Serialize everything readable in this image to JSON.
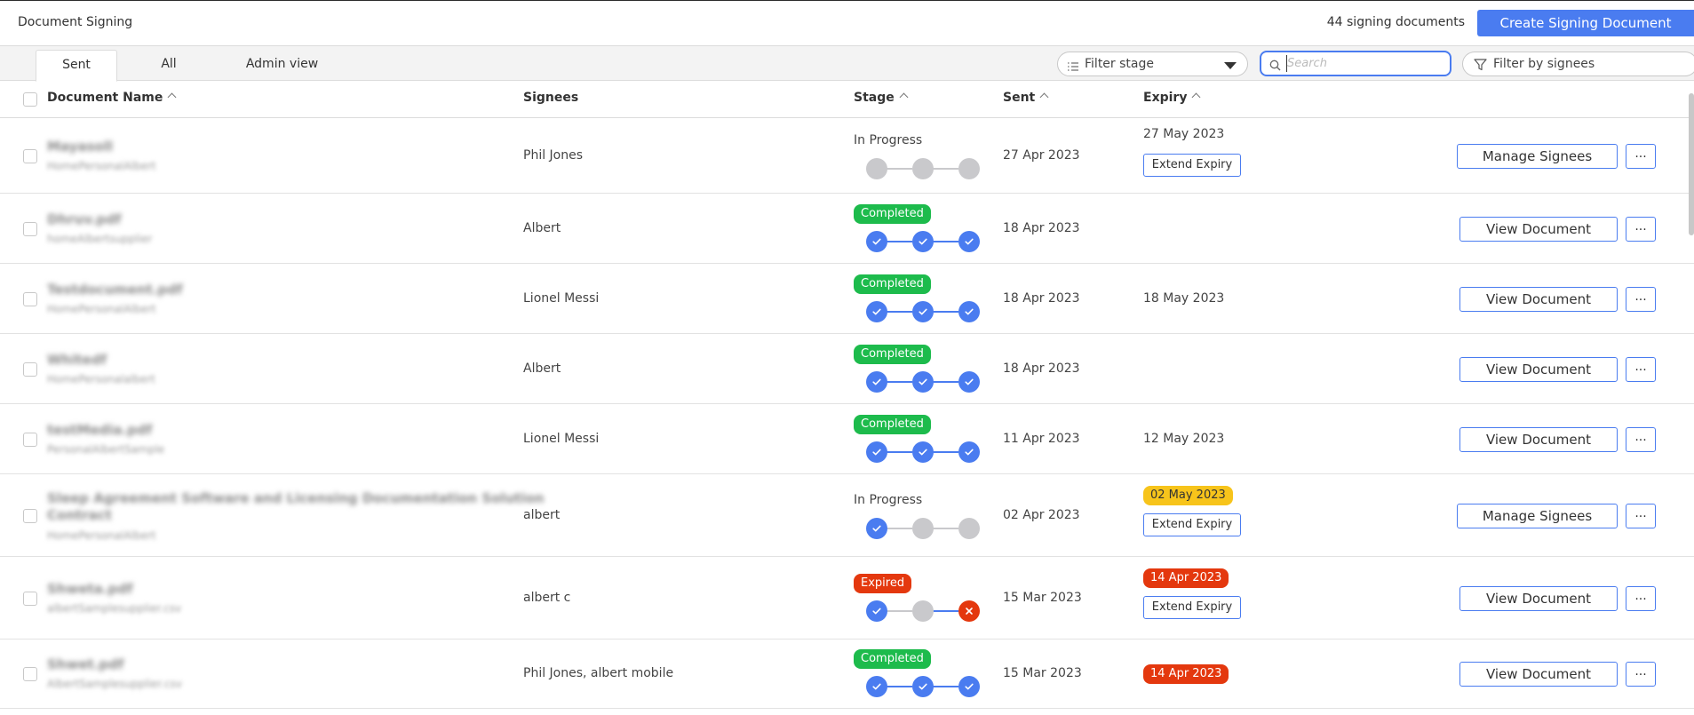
{
  "header": {
    "title": "Document Signing",
    "doc_count": "44 signing documents",
    "create_label": "Create Signing Document"
  },
  "tabs": [
    {
      "label": "Sent",
      "active": true
    },
    {
      "label": "All",
      "active": false
    },
    {
      "label": "Admin view",
      "active": false
    }
  ],
  "filters": {
    "stage_label": "Filter stage",
    "search_placeholder": "Search",
    "signees_label": "Filter by signees"
  },
  "columns": {
    "name": "Document Name",
    "signees": "Signees",
    "stage": "Stage",
    "sent": "Sent",
    "expiry": "Expiry"
  },
  "labels": {
    "extend_expiry": "Extend Expiry",
    "more": "..."
  },
  "colors": {
    "accent": "#4a7cf0",
    "completed": "#1dbb4c",
    "expired": "#e4380e",
    "warning": "#f7c41b"
  },
  "rows": [
    {
      "name": "Mayasoll",
      "sub": "HomePersonalAlbert",
      "signees": "Phil Jones",
      "stage": "In Progress",
      "stage_style": "text",
      "steps": [
        "grey",
        "grey",
        "grey"
      ],
      "sent": "27 Apr 2023",
      "expiry": "27 May 2023",
      "expiry_style": "text",
      "extend": true,
      "action": "Manage Signees"
    },
    {
      "name": "Dhruv.pdf",
      "sub": "homeAlbertsupplier",
      "signees": "Albert",
      "stage": "Completed",
      "stage_style": "green",
      "steps": [
        "blue",
        "blue",
        "blue"
      ],
      "sent": "18 Apr 2023",
      "expiry": "",
      "expiry_style": "text",
      "extend": false,
      "action": "View Document"
    },
    {
      "name": "Testdocument.pdf",
      "sub": "HomePersonalAlbert",
      "signees": "Lionel Messi",
      "stage": "Completed",
      "stage_style": "green",
      "steps": [
        "blue",
        "blue",
        "blue"
      ],
      "sent": "18 Apr 2023",
      "expiry": "18 May 2023",
      "expiry_style": "text",
      "extend": false,
      "action": "View Document"
    },
    {
      "name": "Whitedf",
      "sub": "HomePersonalalbert",
      "signees": "Albert",
      "stage": "Completed",
      "stage_style": "green",
      "steps": [
        "blue",
        "blue",
        "blue"
      ],
      "sent": "18 Apr 2023",
      "expiry": "",
      "expiry_style": "text",
      "extend": false,
      "action": "View Document"
    },
    {
      "name": "testMedia.pdf",
      "sub": "PersonalAlbertSample",
      "signees": "Lionel Messi",
      "stage": "Completed",
      "stage_style": "green",
      "steps": [
        "blue",
        "blue",
        "blue"
      ],
      "sent": "11 Apr 2023",
      "expiry": "12 May 2023",
      "expiry_style": "text",
      "extend": false,
      "action": "View Document"
    },
    {
      "name": "Sleep Agreement Software and Licensing Documentation Solution",
      "name2": "Contract",
      "sub": "HomePersonalAlbert",
      "signees": "albert",
      "stage": "In Progress",
      "stage_style": "text",
      "steps": [
        "blue",
        "grey",
        "grey"
      ],
      "sent": "02 Apr 2023",
      "expiry": "02 May 2023",
      "expiry_style": "yellow",
      "extend": true,
      "action": "Manage Signees"
    },
    {
      "name": "Shweta.pdf",
      "sub": "albertSamplesupplier.csv",
      "signees": "albert c",
      "stage": "Expired",
      "stage_style": "red",
      "steps": [
        "blue",
        "grey",
        "red"
      ],
      "sent": "15 Mar 2023",
      "expiry": "14 Apr 2023",
      "expiry_style": "red",
      "extend": true,
      "action": "View Document"
    },
    {
      "name": "Shwet.pdf",
      "sub": "AlbertSamplesupplier.csv",
      "signees": "Phil Jones, albert mobile",
      "stage": "Completed",
      "stage_style": "green",
      "steps": [
        "blue",
        "blue",
        "blue"
      ],
      "sent": "15 Mar 2023",
      "expiry": "14 Apr 2023",
      "expiry_style": "red",
      "extend": false,
      "action": "View Document"
    }
  ]
}
